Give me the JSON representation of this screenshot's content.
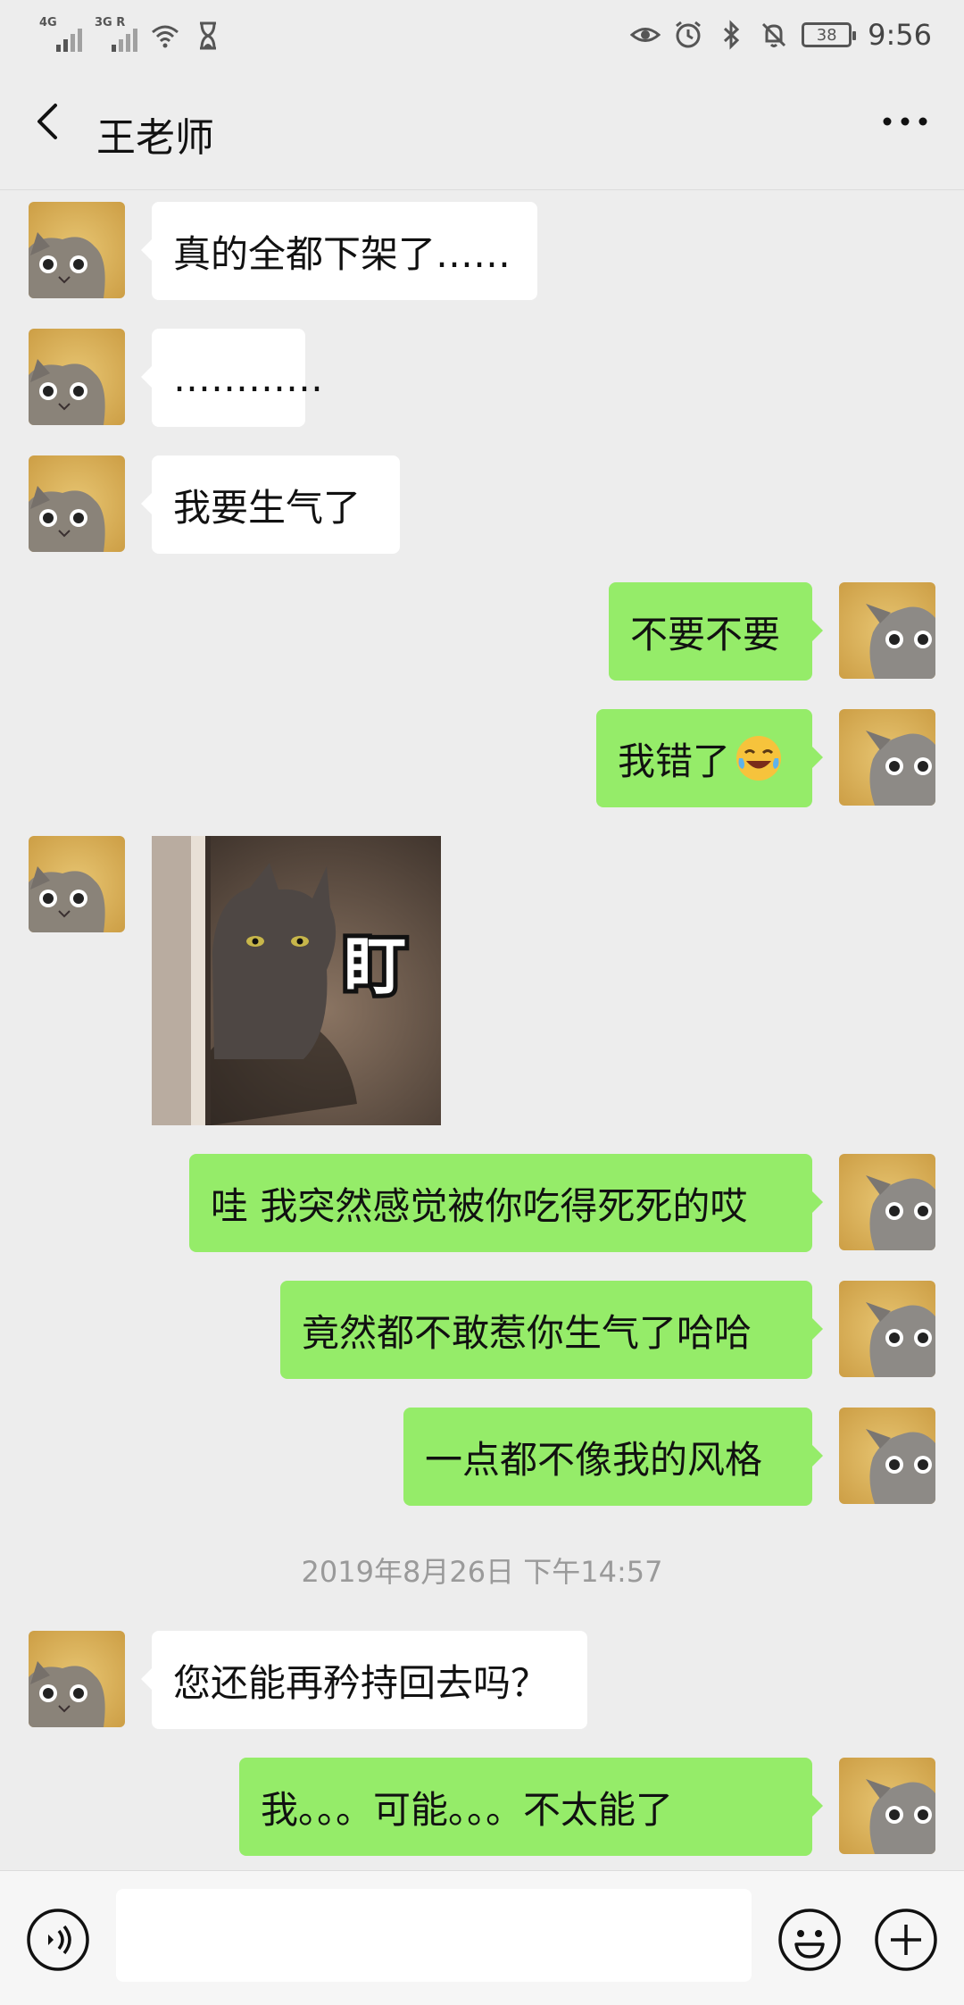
{
  "status_bar": {
    "signal1_label": "4G",
    "signal2_label": "3G R",
    "battery_level": "38",
    "time": "9:56"
  },
  "header": {
    "back_icon": "chevron-left-icon",
    "title": "王老师",
    "more_icon": "more-dots-icon"
  },
  "messages": [
    {
      "side": "left",
      "text": "真的全都下架了……"
    },
    {
      "side": "left",
      "text": "…………"
    },
    {
      "side": "left",
      "text": "我要生气了"
    },
    {
      "side": "right",
      "text": "不要不要"
    },
    {
      "side": "right",
      "text": "我错了",
      "emoji": "laughing-crying-emoji"
    },
    {
      "side": "left",
      "type": "sticker",
      "sticker_text": "盯"
    },
    {
      "side": "right",
      "text": "哇 我突然感觉被你吃得死死的哎"
    },
    {
      "side": "right",
      "text": "竟然都不敢惹你生气了哈哈"
    },
    {
      "side": "right",
      "text": "一点都不像我的风格"
    },
    {
      "side": "left",
      "text": "您还能再矜持回去吗？"
    },
    {
      "side": "right",
      "text": "我。。。可能。。。不太能了"
    }
  ],
  "timestamp": "2019年8月26日 下午14:57",
  "input_bar": {
    "voice_icon": "voice-icon",
    "input_value": "",
    "emoji_icon": "smiley-icon",
    "plus_icon": "plus-icon"
  },
  "colors": {
    "background": "#ededed",
    "bubble_sent": "#95ec69",
    "bubble_received": "#ffffff"
  }
}
